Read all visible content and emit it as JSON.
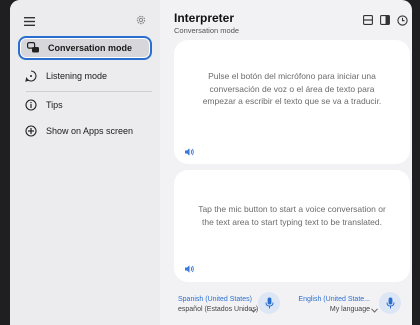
{
  "sidebar": {
    "items": [
      {
        "label": "Conversation mode",
        "icon": "conversation-icon"
      },
      {
        "label": "Listening mode",
        "icon": "listening-icon"
      },
      {
        "label": "Tips",
        "icon": "info-icon"
      },
      {
        "label": "Show on Apps screen",
        "icon": "add-circle-icon"
      }
    ]
  },
  "header": {
    "title": "Interpreter",
    "subtitle": "Conversation mode"
  },
  "panels": {
    "top_message": "Pulse el botón del micrófono para iniciar una conversación de voz o el área de texto para empezar a escribir el texto que se va a traducir.",
    "bottom_message": "Tap the mic button to start a voice conversation or the text area to start typing text to be translated."
  },
  "languages": {
    "left": {
      "name": "Spanish (United States)",
      "native": "español (Estados Unidos)"
    },
    "right": {
      "name": "English (United State...",
      "native": "My language"
    }
  },
  "colors": {
    "accent": "#2a6fcf",
    "background": "#f2f2f5",
    "card": "#ffffff"
  }
}
